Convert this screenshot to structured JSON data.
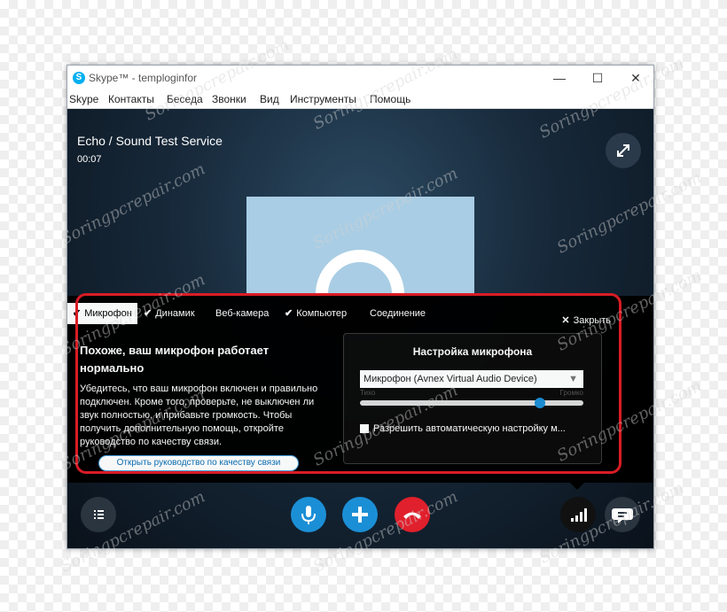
{
  "window": {
    "app_icon": "S",
    "title": "Skype™ - temploginfor",
    "controls": {
      "minimize": "—",
      "maximize": "☐",
      "close": "✕"
    }
  },
  "menu": [
    "Skype",
    "Контакты",
    "Беседа",
    "Звонки",
    "Вид",
    "Инструменты",
    "Помощь"
  ],
  "call": {
    "title": "Echo / Sound Test Service",
    "duration": "00:07"
  },
  "panel": {
    "tabs": [
      {
        "label": "Микрофон",
        "checked": true,
        "active": true
      },
      {
        "label": "Динамик",
        "checked": true,
        "active": false
      },
      {
        "label": "Веб-камера",
        "checked": false,
        "active": false
      },
      {
        "label": "Компьютер",
        "checked": true,
        "active": false
      },
      {
        "label": "Соединение",
        "checked": false,
        "active": false
      }
    ],
    "close_label": "Закрыть",
    "headline": "Похоже, ваш микрофон работает нормально",
    "body": "Убедитесь, что ваш микрофон включен и правильно подключен. Кроме того, проверьте, не выключен ли звук полностью, и прибавьте громкость. Чтобы получить дополнительную помощь, откройте руководство по качеству связи.",
    "guide_button": "Открыть руководство по качеству связи",
    "settings": {
      "title": "Настройка микрофона",
      "device": "Микрофон (Avnex Virtual Audio Device)",
      "quiet_label": "Тихо",
      "loud_label": "Громко",
      "volume_level": 0.82,
      "auto_adjust_label": "Разрешить автоматическую настройку м...",
      "auto_adjust_checked": false
    }
  },
  "controls": {
    "mic_color": "#1b8fd6",
    "add_color": "#1b8fd6",
    "hangup_color": "#e0202c"
  },
  "colors": {
    "highlight_frame": "#d91c25",
    "accent": "#1b8fd6"
  },
  "watermark": "Soringpcrepair.com"
}
